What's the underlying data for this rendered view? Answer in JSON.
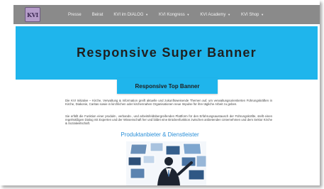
{
  "logo": {
    "text": "KVI"
  },
  "nav": {
    "items": [
      {
        "label": "Presse",
        "dropdown": false
      },
      {
        "label": "Beirat",
        "dropdown": false
      },
      {
        "label": "KVI im DIALOG",
        "dropdown": true
      },
      {
        "label": "KVI Kongress",
        "dropdown": true
      },
      {
        "label": "KVI Academy",
        "dropdown": true
      },
      {
        "label": "KVI Shop",
        "dropdown": true
      }
    ],
    "caret": "▼"
  },
  "super_banner": {
    "text": "Responsive Super Banner"
  },
  "top_banner": {
    "text": "Responsive Top Banner"
  },
  "content": {
    "paragraph1": "Die KVI Initiative – Kirche, Verwaltung & Information greift aktuelle und zukunftsweisende Themen auf, um verwaltungsorientierten Führungskräften in Kirche, Diakonie, Caritas sowie in kirchlichen oder kirchennahen Organisationen neue Impulse für ihre tägliche Arbeit zu geben.",
    "paragraph2": "Sie erfüllt die Funktion einer produkt-, verbands-, und arbeitsfeldübergreifenden Plattform für den Erfahrungsaustausch der Führungskräfte, stellt einen regelmäßigen Dialog mit Experten und der Wissenschaft her und bildet eine Brückenfunktion zwischen anbietenden Unternehmen und dem Sektor Kirche & Sozialwirtschaft.",
    "section_heading": "Produktanbieter & Dienstleister"
  },
  "colors": {
    "banner": "#1fb5ec",
    "nav_bg": "#8a8a8a",
    "heading": "#2a8fd8"
  }
}
